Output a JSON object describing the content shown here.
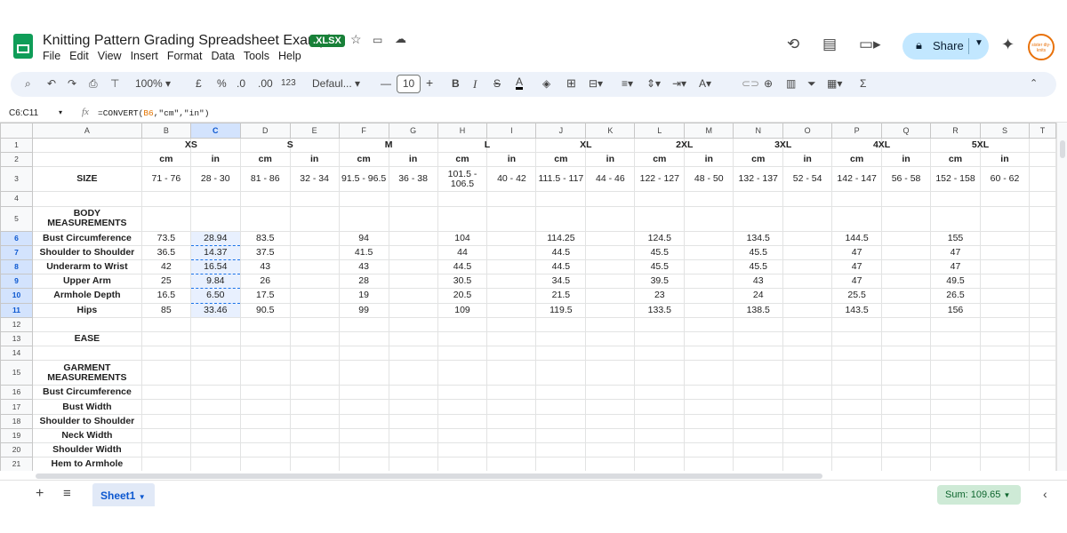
{
  "app": {
    "title": "Knitting Pattern Grading Spreadsheet Example",
    "badge": ".XLSX",
    "menu": [
      "File",
      "Edit",
      "View",
      "Insert",
      "Format",
      "Data",
      "Tools",
      "Help"
    ],
    "share_label": "Share",
    "avatar_text": "sister\ndiy-knits"
  },
  "toolbar": {
    "zoom": "100%",
    "currency": "£",
    "percent": "%",
    "decrease_decimal": ".0",
    "increase_decimal": ".00",
    "number_format": "123",
    "font": "Defaul...",
    "font_size": "10"
  },
  "formula_bar": {
    "name_box": "C6:C11",
    "fx": "fx",
    "formula_prefix": "=CONVERT(",
    "formula_ref": "B6",
    "formula_suffix": ",\"cm\",\"in\")"
  },
  "grid": {
    "columns": [
      "A",
      "B",
      "C",
      "D",
      "E",
      "F",
      "G",
      "H",
      "I",
      "J",
      "K",
      "L",
      "M",
      "N",
      "O",
      "P",
      "Q",
      "R",
      "S",
      "T"
    ],
    "rows": [
      [
        "1",
        "",
        "XS",
        "",
        "S",
        "",
        "M",
        "",
        "L",
        "",
        "XL",
        "",
        "2XL",
        "",
        "3XL",
        "",
        "4XL",
        "",
        "5XL",
        ""
      ],
      [
        "2",
        "",
        "cm",
        "in",
        "cm",
        "in",
        "cm",
        "in",
        "cm",
        "in",
        "cm",
        "in",
        "cm",
        "in",
        "cm",
        "in",
        "cm",
        "in",
        "cm",
        "in"
      ],
      [
        "3",
        "SIZE",
        "71 - 76",
        "28 - 30",
        "81 - 86",
        "32 - 34",
        "91.5 - 96.5",
        "36 - 38",
        "101.5 -\n106.5",
        "40 - 42",
        "111.5 - 117",
        "44 - 46",
        "122 - 127",
        "48 - 50",
        "132 - 137",
        "52 - 54",
        "142 - 147",
        "56 - 58",
        "152 - 158",
        "60 - 62"
      ],
      [
        "4",
        "",
        "",
        "",
        "",
        "",
        "",
        "",
        "",
        "",
        "",
        "",
        "",
        "",
        "",
        "",
        "",
        "",
        "",
        ""
      ],
      [
        "5",
        "BODY\nMEASUREMENTS",
        "",
        "",
        "",
        "",
        "",
        "",
        "",
        "",
        "",
        "",
        "",
        "",
        "",
        "",
        "",
        "",
        "",
        ""
      ],
      [
        "6",
        "Bust Circumference",
        "73.5",
        "28.94",
        "83.5",
        "",
        "94",
        "",
        "104",
        "",
        "114.25",
        "",
        "124.5",
        "",
        "134.5",
        "",
        "144.5",
        "",
        "155",
        ""
      ],
      [
        "7",
        "Shoulder to Shoulder",
        "36.5",
        "14.37",
        "37.5",
        "",
        "41.5",
        "",
        "44",
        "",
        "44.5",
        "",
        "45.5",
        "",
        "45.5",
        "",
        "47",
        "",
        "47",
        ""
      ],
      [
        "8",
        "Underarm to Wrist",
        "42",
        "16.54",
        "43",
        "",
        "43",
        "",
        "44.5",
        "",
        "44.5",
        "",
        "45.5",
        "",
        "45.5",
        "",
        "47",
        "",
        "47",
        ""
      ],
      [
        "9",
        "Upper Arm",
        "25",
        "9.84",
        "26",
        "",
        "28",
        "",
        "30.5",
        "",
        "34.5",
        "",
        "39.5",
        "",
        "43",
        "",
        "47",
        "",
        "49.5",
        ""
      ],
      [
        "10",
        "Armhole Depth",
        "16.5",
        "6.50",
        "17.5",
        "",
        "19",
        "",
        "20.5",
        "",
        "21.5",
        "",
        "23",
        "",
        "24",
        "",
        "25.5",
        "",
        "26.5",
        ""
      ],
      [
        "11",
        "Hips",
        "85",
        "33.46",
        "90.5",
        "",
        "99",
        "",
        "109",
        "",
        "119.5",
        "",
        "133.5",
        "",
        "138.5",
        "",
        "143.5",
        "",
        "156",
        ""
      ],
      [
        "12",
        "",
        "",
        "",
        "",
        "",
        "",
        "",
        "",
        "",
        "",
        "",
        "",
        "",
        "",
        "",
        "",
        "",
        "",
        ""
      ],
      [
        "13",
        "EASE",
        "",
        "",
        "",
        "",
        "",
        "",
        "",
        "",
        "",
        "",
        "",
        "",
        "",
        "",
        "",
        "",
        "",
        ""
      ],
      [
        "14",
        "",
        "",
        "",
        "",
        "",
        "",
        "",
        "",
        "",
        "",
        "",
        "",
        "",
        "",
        "",
        "",
        "",
        "",
        ""
      ],
      [
        "15",
        "GARMENT\nMEASUREMENTS",
        "",
        "",
        "",
        "",
        "",
        "",
        "",
        "",
        "",
        "",
        "",
        "",
        "",
        "",
        "",
        "",
        "",
        ""
      ],
      [
        "16",
        "Bust Circumference",
        "",
        "",
        "",
        "",
        "",
        "",
        "",
        "",
        "",
        "",
        "",
        "",
        "",
        "",
        "",
        "",
        "",
        ""
      ],
      [
        "17",
        "Bust Width",
        "",
        "",
        "",
        "",
        "",
        "",
        "",
        "",
        "",
        "",
        "",
        "",
        "",
        "",
        "",
        "",
        "",
        ""
      ],
      [
        "18",
        "Shoulder to Shoulder",
        "",
        "",
        "",
        "",
        "",
        "",
        "",
        "",
        "",
        "",
        "",
        "",
        "",
        "",
        "",
        "",
        "",
        ""
      ],
      [
        "19",
        "Neck Width",
        "",
        "",
        "",
        "",
        "",
        "",
        "",
        "",
        "",
        "",
        "",
        "",
        "",
        "",
        "",
        "",
        "",
        ""
      ],
      [
        "20",
        "Shoulder Width",
        "",
        "",
        "",
        "",
        "",
        "",
        "",
        "",
        "",
        "",
        "",
        "",
        "",
        "",
        "",
        "",
        "",
        ""
      ],
      [
        "21",
        "Hem to Armhole",
        "",
        "",
        "",
        "",
        "",
        "",
        "",
        "",
        "",
        "",
        "",
        "",
        "",
        "",
        "",
        "",
        "",
        ""
      ]
    ]
  },
  "sheet_tab": "Sheet1",
  "sum_label": "Sum: 109.65"
}
